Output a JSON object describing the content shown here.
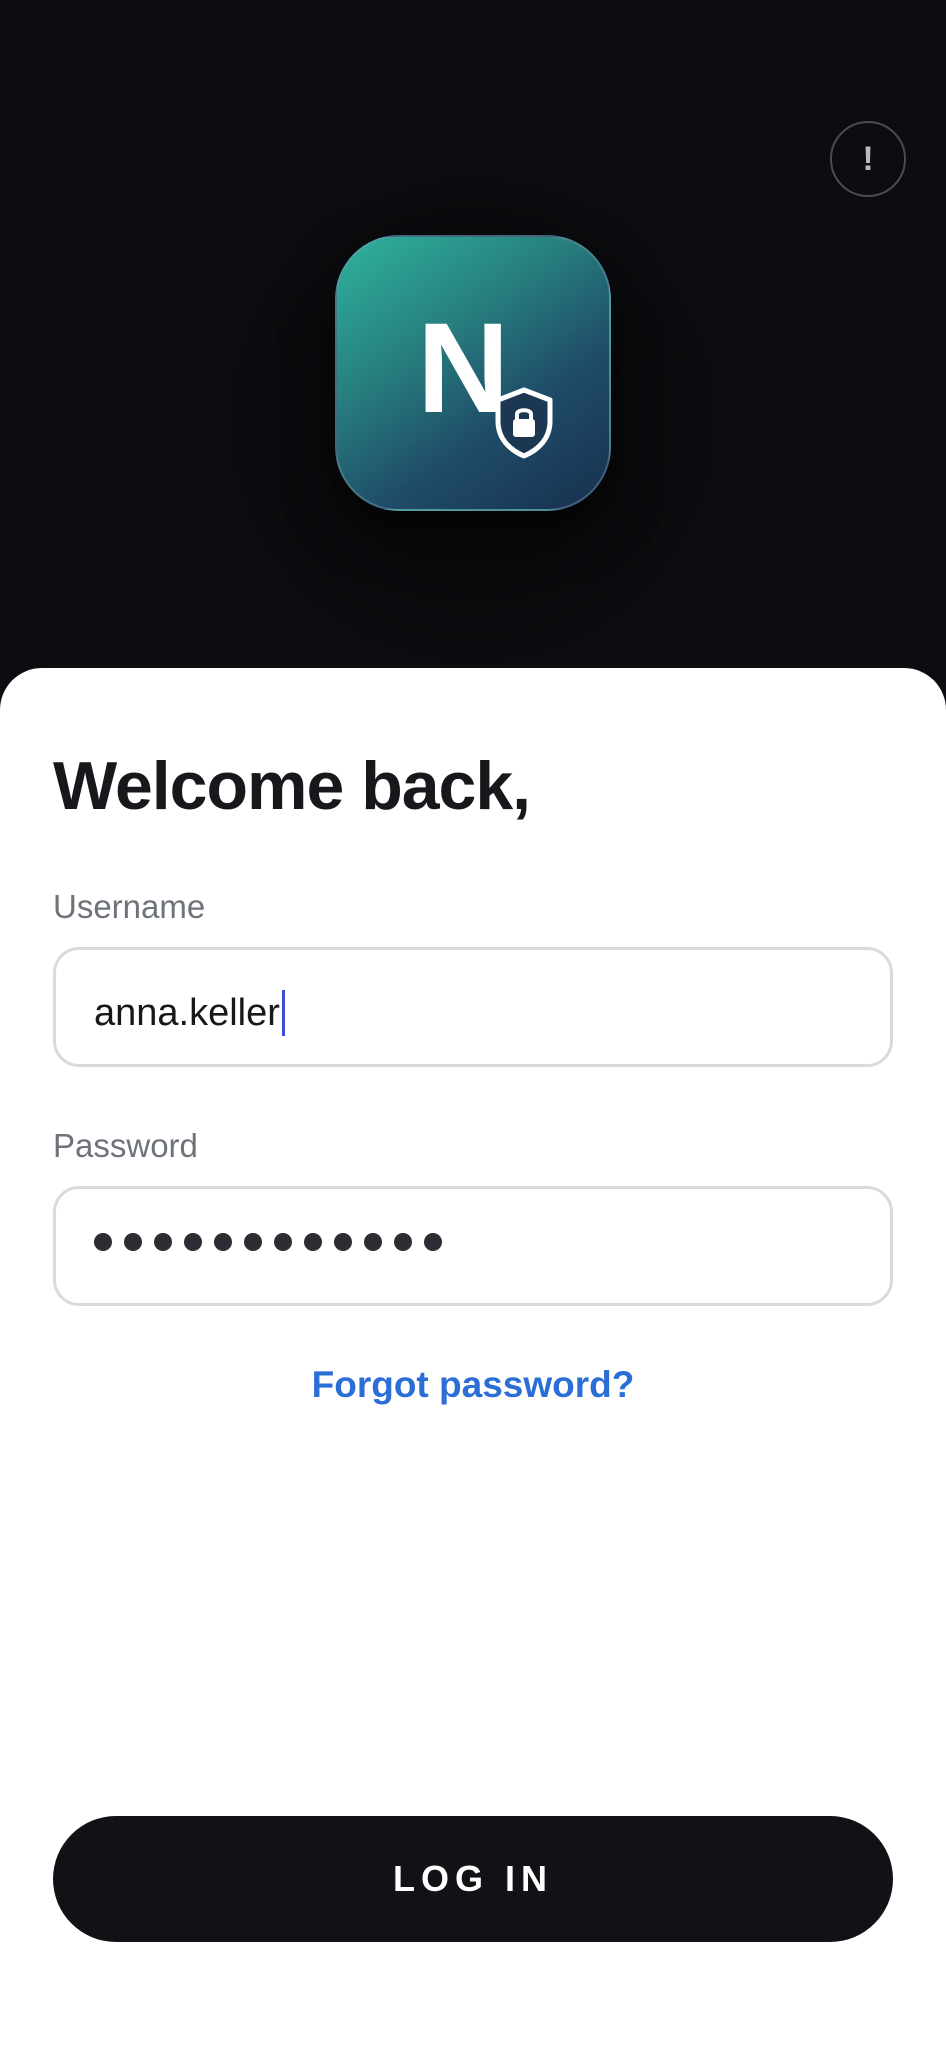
{
  "header": {
    "alert_label": "!",
    "logo_letter": "N",
    "icons": {
      "logo": "shield-lock-icon",
      "alert": "exclamation-icon"
    }
  },
  "login": {
    "title": "Welcome back,",
    "username_label": "Username",
    "username_value": "anna.keller",
    "password_label": "Password",
    "password_masked_length": 12,
    "forgot_label": "Forgot password?",
    "submit_label": "LOG IN"
  },
  "colors": {
    "background": "#0c0d10",
    "accent_link": "#2b6fd6",
    "button": "#111216",
    "caret": "#3b4cd6",
    "logo_gradient_start": "#2fb39e",
    "logo_gradient_end": "#17304f"
  }
}
